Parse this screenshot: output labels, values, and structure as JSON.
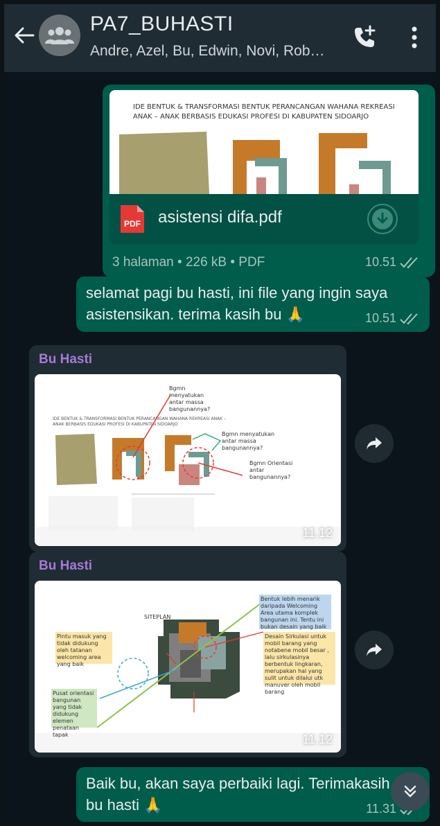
{
  "header": {
    "title": "PA7_BUHASTI",
    "subtitle": "Andre, Azel, Bu, Edwin, Novi, Rob…",
    "back_icon": "arrow-left-icon",
    "avatar_icon": "group-icon",
    "call_icon": "add-call-icon",
    "menu_icon": "more-vertical-icon"
  },
  "messages": {
    "doc": {
      "preview_title": "IDE BENTUK & TRANSFORMASI BENTUK PERANCANGAN WAHANA REKREASI ANAK – ANAK BERBASIS EDUKASI PROFESI DI KABUPATEN SIDOARJO",
      "file_icon_label": "PDF",
      "file_name": "asistensi difa.pdf",
      "meta": "3 halaman • 226 kB • PDF",
      "time": "10.51"
    },
    "text1": {
      "text": "selamat pagi bu hasti, ini file yang ingin saya asistensikan. terima kasih bu 🙏",
      "time": "10.51"
    },
    "image1": {
      "sender": "Bu Hasti",
      "time": "11.12",
      "slide_title": "IDE BENTUK & TRANSFORMASI BENTUK PERANCANGAN WAHANA REKREASI ANAK – ANAK BERBASIS EDUKASI PROFESI DI KABUPATEN SIDOARJO",
      "annotations": [
        "Bgmn menyatukan antar massa bangunannya?",
        "Bgmn menyatukan antar massa bangunannya?",
        "Bgmn Orientasi antar bangunannya?"
      ]
    },
    "image2": {
      "sender": "Bu Hasti",
      "time": "11.12",
      "slide_label": "SITEPLAN",
      "annotations": [
        "Bentuk lebih menarik daripada Welcoming Area utama komplek bangunan ini. Tentu ini bukan desain yang baik",
        "Pintu masuk yang tidak didukung oleh tatanan welcoming area yang baik",
        "Desain Sirkulasi untuk mobil barang yang notabene mobil besar , lalu sirkulasinya berbentuk lingkaran, merupakan hal yang sulit untuk dilalui utk manuver oleh mobil barang",
        "Pusat orientasi bangunan yang tidak didukung elemen penataan tapak"
      ]
    },
    "text2": {
      "text": "Baik bu, akan saya perbaiki lagi. Terimakasih bu hasti 🙏",
      "time": "11.31"
    }
  },
  "colors": {
    "header_bg": "#1f2c34",
    "chat_bg": "#0b141a",
    "outgoing_bubble": "#005c4b",
    "incoming_bubble": "#202c33",
    "sender_name": "#a57ad8",
    "read_ticks": "#a7c4be"
  }
}
